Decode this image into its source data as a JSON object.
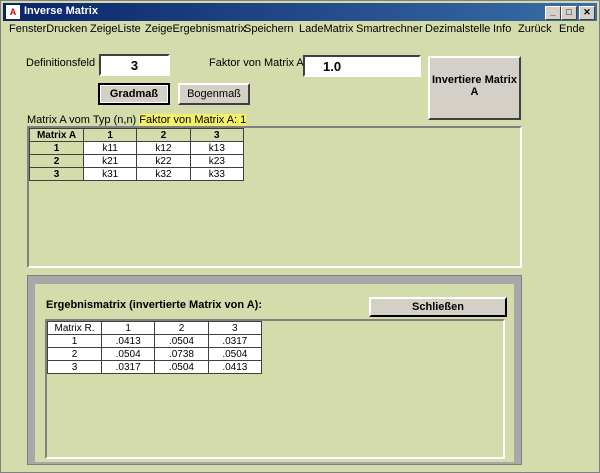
{
  "window": {
    "title": "Inverse Matrix"
  },
  "titlebar": {
    "minimize": "_",
    "maximize": "□",
    "close": "✕"
  },
  "menu": [
    "FensterDrucken",
    "ZeigeListe",
    "ZeigeErgebnismatrix",
    "Speichern",
    "LadeMatrix",
    "Smartrechner",
    "Dezimalstelle",
    "Info",
    "Zurück",
    "Ende"
  ],
  "form": {
    "n_label": "Definitionsfeld n:",
    "n_value": "3",
    "factor_label": "Faktor von Matrix A:",
    "factor_value": "1.0",
    "invert_button": "Invertiere Matrix A",
    "grad_button": "Gradmaß",
    "bogen_button": "Bogenmaß"
  },
  "matrix_a": {
    "caption": "Matrix A vom Typ (n,n)",
    "caption_highlight": "Faktor von Matrix A: 1",
    "headers": [
      "Matrix A",
      "1",
      "2",
      "3"
    ],
    "rows": [
      {
        "label": "1",
        "cells": [
          "k11",
          "k12",
          "k13"
        ]
      },
      {
        "label": "2",
        "cells": [
          "k21",
          "k22",
          "k23"
        ]
      },
      {
        "label": "3",
        "cells": [
          "k31",
          "k32",
          "k33"
        ]
      }
    ]
  },
  "result": {
    "title": "Ergebnismatrix (invertierte Matrix von A):",
    "close_button": "Schließen",
    "headers": [
      "Matrix R.",
      "1",
      "2",
      "3"
    ],
    "rows": [
      {
        "label": "1",
        "cells": [
          ".0413",
          ".0504",
          ".0317"
        ]
      },
      {
        "label": "2",
        "cells": [
          ".0504",
          ".0738",
          ".0504"
        ]
      },
      {
        "label": "3",
        "cells": [
          ".0317",
          ".0504",
          ".0413"
        ]
      }
    ]
  }
}
